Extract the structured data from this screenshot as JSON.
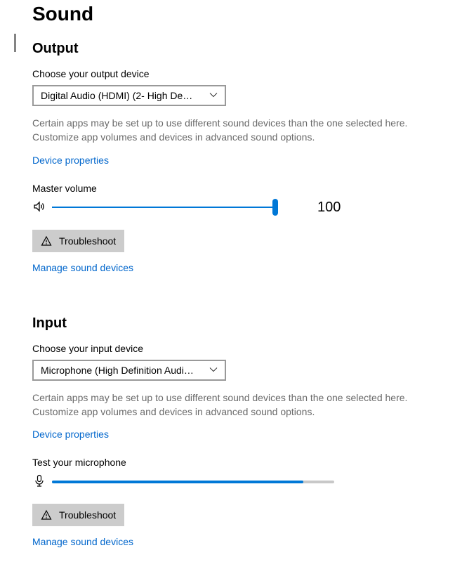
{
  "page": {
    "title": "Sound"
  },
  "output": {
    "heading": "Output",
    "choose_label": "Choose your output device",
    "device_selected": "Digital Audio (HDMI) (2- High Defini...",
    "helper": "Certain apps may be set up to use different sound devices than the one selected here. Customize app volumes and devices in advanced sound options.",
    "device_properties": "Device properties",
    "master_label": "Master volume",
    "volume_value": "100",
    "volume_percent": 100,
    "troubleshoot_label": "Troubleshoot",
    "manage_devices": "Manage sound devices"
  },
  "input": {
    "heading": "Input",
    "choose_label": "Choose your input device",
    "device_selected": "Microphone (High Definition Audio...",
    "helper": "Certain apps may be set up to use different sound devices than the one selected here. Customize app volumes and devices in advanced sound options.",
    "device_properties": "Device properties",
    "test_label": "Test your microphone",
    "mic_level_percent": 89,
    "troubleshoot_label": "Troubleshoot",
    "manage_devices": "Manage sound devices"
  }
}
